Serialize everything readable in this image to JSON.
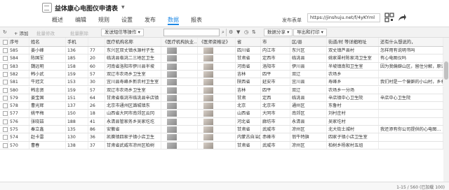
{
  "header": {
    "form_title": "益体康心电图仪申请表",
    "tabs": [
      {
        "label": "概述"
      },
      {
        "label": "编辑"
      },
      {
        "label": "规则"
      },
      {
        "label": "设置"
      },
      {
        "label": "发布"
      },
      {
        "label": "数据"
      },
      {
        "label": "报表"
      }
    ],
    "active_tab": "数据",
    "publish_label": "发布表单",
    "publish_url": "https://jinshuju.net/f/4yKYml"
  },
  "toolbar": {
    "refresh_icon": "refresh-icon",
    "add_label": "+ 添加",
    "batch_edit_label": "批量修改",
    "batch_delete_label": "批量删除",
    "send_label": "发送短信等操作",
    "search_placeholder": "",
    "data_share_label": "数据分享",
    "export_label": "导出和打印"
  },
  "table": {
    "columns": [
      "序号",
      "姓名",
      "手机",
      "",
      "医疗机构名称",
      "《医疗机构执业…",
      "《医师资格证》",
      "省",
      "市",
      "区/县",
      "街道/村 等详细地址",
      "还有什么想说的，"
    ],
    "rows": [
      [
        "585",
        "姜小峰",
        "136",
        "77",
        "东兴区双丈镇水源村子生",
        "",
        "",
        "四川省",
        "内江市",
        "东兴区",
        "双丈镇芦县村",
        "怎样用有说明书吗"
      ],
      [
        "584",
        "陈国军",
        "185",
        "20",
        "临洮县临洮二三地区卫生",
        "",
        "",
        "甘肃省",
        "定西市",
        "临洮县",
        "姚家渠村陈家湾卫生室",
        "有心电图仪吗"
      ],
      [
        "583",
        "魏远明",
        "158",
        "60",
        "河南省洛阳市伊川县半坡",
        "",
        "",
        "河南省",
        "洛阳市",
        "伊川县",
        "半坡镇南阳卫生室",
        "因为我偏僻山区，留住分解，原谅…"
      ],
      [
        "582",
        "韩小武",
        "159",
        "57",
        "双辽市农场乡卫生室",
        "",
        "",
        "吉林",
        "四平",
        "双辽",
        "农场乡",
        ""
      ],
      [
        "581",
        "牛冠文",
        "153",
        "30",
        "宜川县寿峰乡新农村卫生室",
        "",
        "",
        "陕西省",
        "延安市",
        "宜川县",
        "寿峰乡",
        "我们村是一个偏僻的小山村，乡村…"
      ],
      [
        "580",
        "韩忠贤",
        "159",
        "57",
        "双辽市农场乡卫生室",
        "",
        "",
        "吉林",
        "四平",
        "双辽",
        "农场乡一分场",
        ""
      ],
      [
        "579",
        "姜宝国",
        "151",
        "64",
        "甘肃省临洮市临洮县辛店镇",
        "",
        "",
        "甘肃",
        "定西",
        "临洮县",
        "辛店镇中心卫生院",
        "辛店中心卫生院"
      ],
      [
        "578",
        "曹光辉",
        "137",
        "26",
        "北京市通州区潞城镇东",
        "",
        "",
        "北京",
        "北京市",
        "通州区",
        "东鲁村",
        ""
      ],
      [
        "577",
        "姚平梅",
        "150",
        "18",
        "山西省大同市南郊区云冈",
        "",
        "",
        "山西省",
        "大同市",
        "南郊区",
        "刘村庄村",
        ""
      ],
      [
        "576",
        "张晓喆",
        "188",
        "41",
        "永清县管家务乡吴家圪圪",
        "",
        "",
        "河北省",
        "廊坊市",
        "永清县",
        "吴家圪村",
        ""
      ],
      [
        "575",
        "秦立鑫",
        "135",
        "86",
        "安徽省",
        "",
        "",
        "甘肃省",
        "武威市",
        "凉州区",
        "北大街土城村",
        "我还添有你公司提供的心电图…"
      ],
      [
        "574",
        "赵卡雷",
        "130",
        "36",
        "凯赛镇四家子镇小店卫生",
        "",
        "",
        "内蒙古自治区",
        "赤峰市",
        "翁牛特旗",
        "四家子镇小店卫生室",
        ""
      ],
      [
        "570",
        "曹春",
        "138",
        "37",
        "甘肃省武威市凉州区柏树",
        "",
        "",
        "甘肃省",
        "武威市",
        "凉州区",
        "柏树乡杨家村五组",
        ""
      ]
    ]
  },
  "pagination": {
    "text": "1-15 / 560 (已加载 100)"
  }
}
